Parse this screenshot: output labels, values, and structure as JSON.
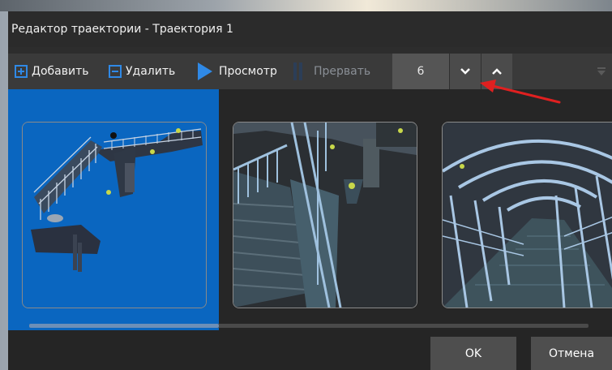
{
  "window": {
    "title": "Редактор траектории  -  Траектория 1"
  },
  "toolbar": {
    "add_label": "Добавить",
    "delete_label": "Удалить",
    "preview_label": "Просмотр",
    "abort_label": "Прервать",
    "frame_value": "6"
  },
  "icons": {
    "add": "plus-square-icon",
    "delete": "minus-square-icon",
    "preview": "play-icon",
    "abort": "pause-icon",
    "down": "chevron-down-icon",
    "up": "chevron-up-icon",
    "overflow": "overflow-icon"
  },
  "thumbnails": {
    "count": 3,
    "selected_index": 0
  },
  "footer": {
    "ok_label": "OK",
    "cancel_label": "Отмена"
  },
  "colors": {
    "accent": "#0a66c0",
    "icon_blue": "#2f89e6",
    "annotation_arrow": "#e02020"
  }
}
